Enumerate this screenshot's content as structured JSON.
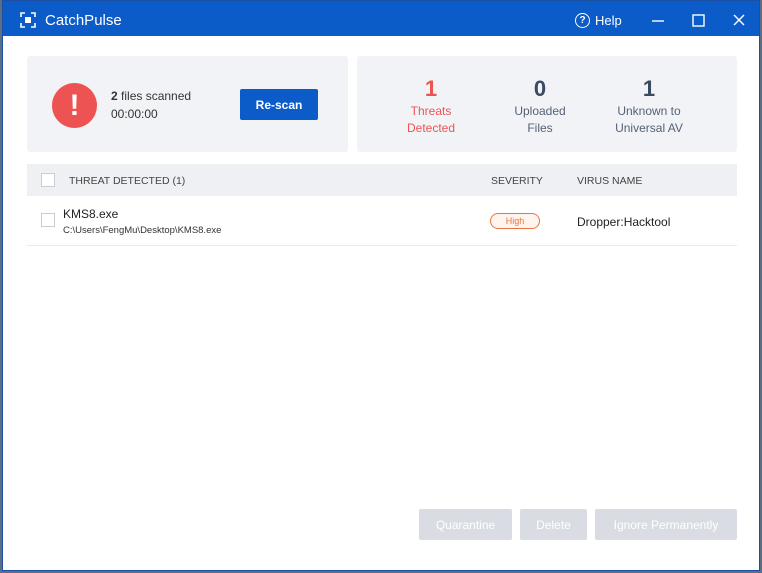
{
  "window": {
    "title": "CatchPulse",
    "help_label": "Help",
    "accent": "#0b5bc9"
  },
  "scan": {
    "files_count": "2",
    "files_label": "files scanned",
    "elapsed": "00:00:00",
    "rescan_label": "Re-scan"
  },
  "stats": [
    {
      "value": "1",
      "label_line1": "Threats",
      "label_line2": "Detected",
      "color": "#ee5353"
    },
    {
      "value": "0",
      "label_line1": "Uploaded",
      "label_line2": "Files"
    },
    {
      "value": "1",
      "label_line1": "Unknown to",
      "label_line2": "Universal AV"
    }
  ],
  "table": {
    "headers": {
      "threat": "THREAT DETECTED (1)",
      "severity": "SEVERITY",
      "virus": "VIRUS NAME"
    },
    "rows": [
      {
        "file_name": "KMS8.exe",
        "file_path": "C:\\Users\\FengMu\\Desktop\\KMS8.exe",
        "severity": "High",
        "virus_name": "Dropper:Hacktool"
      }
    ]
  },
  "actions": {
    "quarantine": "Quarantine",
    "delete": "Delete",
    "ignore": "Ignore Permanently"
  }
}
